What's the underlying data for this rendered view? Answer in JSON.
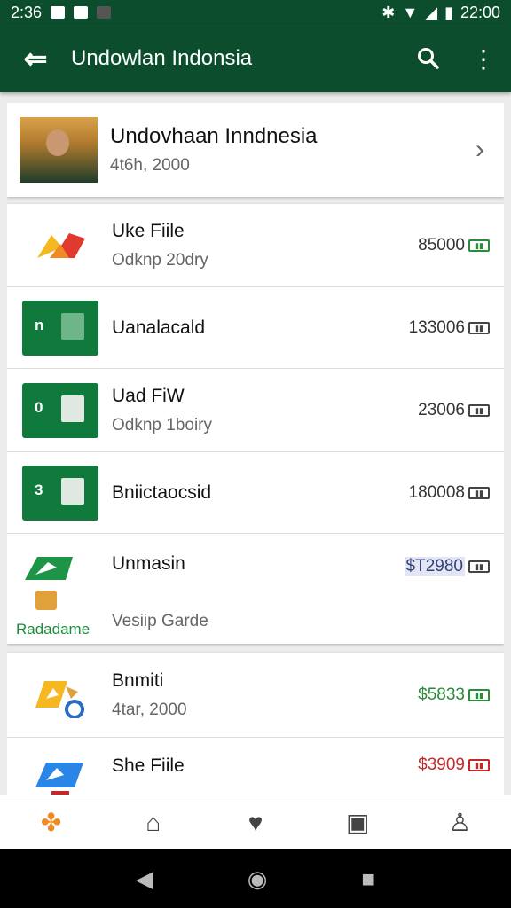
{
  "status_bar": {
    "time": "2:36",
    "right_time": "22:00"
  },
  "app_bar": {
    "title": "Undowlan Indonsia"
  },
  "header_card": {
    "title": "Undovhaan Inndnesia",
    "subtitle": "4t6h, 2000"
  },
  "group1": [
    {
      "name": "Uke Fiile",
      "sub": "Odknp 20dry",
      "amount": "85000",
      "badge": "green",
      "thumb": "folded-red"
    },
    {
      "name": "Uanalacald",
      "sub": "",
      "amount": "133006",
      "badge": "plain",
      "thumb": "green-tile",
      "tile_label": "n"
    },
    {
      "name": "Uad FiW",
      "sub": "Odknp 1boiry",
      "amount": "23006",
      "badge": "plain",
      "thumb": "green-tile",
      "tile_label": "0"
    },
    {
      "name": "Bniictaocsid",
      "sub": "",
      "amount": "180008",
      "badge": "plain",
      "thumb": "green-tile",
      "tile_label": "3"
    },
    {
      "name": "Unmasin",
      "sub": "Vesiip Garde",
      "amount": "$T2980",
      "badge": "plain",
      "thumb": "green-folded",
      "side_label": "Radadame"
    }
  ],
  "group2": [
    {
      "name": "Bnmiti",
      "sub": "4tar, 2000",
      "amount": "$5833",
      "badge": "green",
      "thumb": "yellow-folded"
    },
    {
      "name": "She Fiile",
      "sub": "",
      "amount": "$3909",
      "badge": "red",
      "thumb": "blue-folded"
    }
  ],
  "bottom_nav": [
    "app-logo-icon",
    "home-icon",
    "heart-icon",
    "photo-icon",
    "profile-icon"
  ],
  "colors": {
    "primary": "#0b4d2c",
    "positive": "#2a8c3a",
    "negative": "#c62828"
  }
}
